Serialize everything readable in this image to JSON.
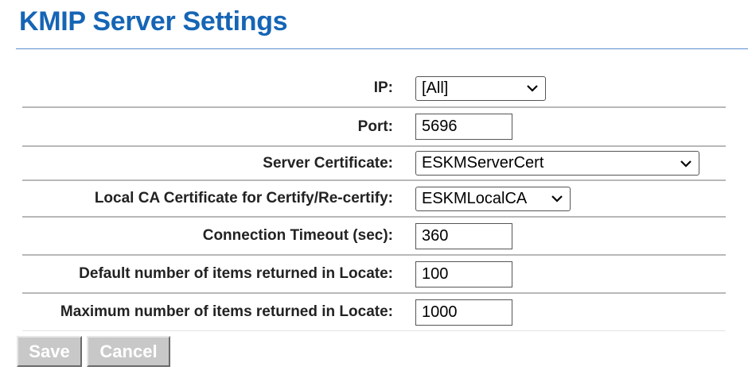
{
  "page": {
    "title": "KMIP Server Settings"
  },
  "fields": {
    "ip": {
      "label": "IP:",
      "value": "[All]"
    },
    "port": {
      "label": "Port:",
      "value": "5696"
    },
    "server_cert": {
      "label": "Server Certificate:",
      "value": "ESKMServerCert"
    },
    "local_ca": {
      "label": "Local CA Certificate for Certify/Re-certify:",
      "value": "ESKMLocalCA"
    },
    "timeout": {
      "label": "Connection Timeout (sec):",
      "value": "360"
    },
    "default_items": {
      "label": "Default number of items returned in Locate:",
      "value": "100"
    },
    "max_items": {
      "label": "Maximum number of items returned in Locate:",
      "value": "1000"
    }
  },
  "buttons": {
    "save": "Save",
    "cancel": "Cancel"
  },
  "icons": {
    "dropdown": "chevron-down-icon"
  },
  "colors": {
    "title": "#1565b5",
    "rule": "#5a8fcd",
    "button_disabled": "#c8c8c8"
  }
}
